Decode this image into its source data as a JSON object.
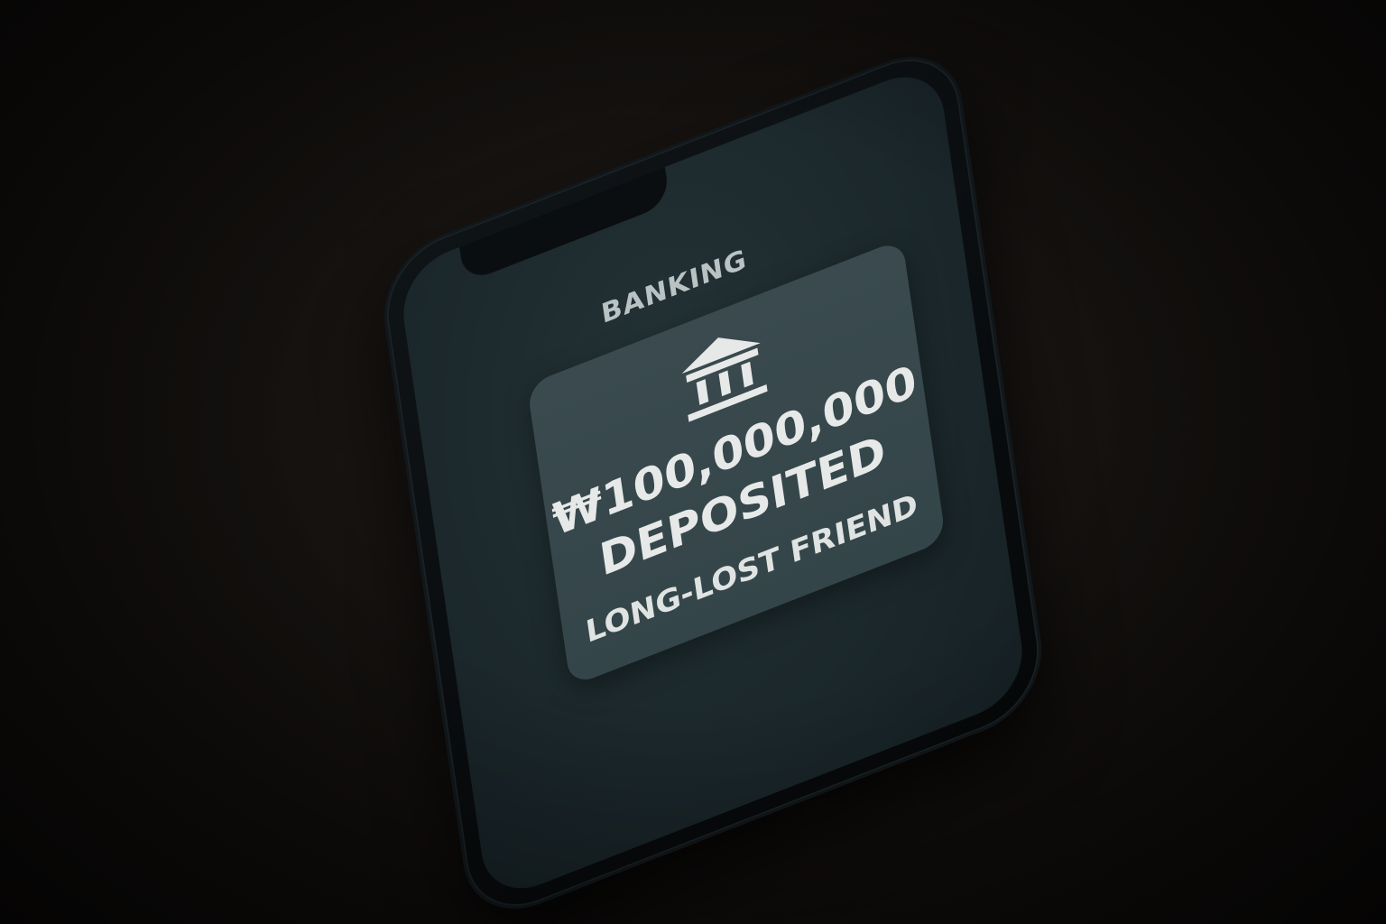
{
  "screen": {
    "title": "BANKING"
  },
  "notification": {
    "icon": "bank-icon",
    "amount": "₩100,000,000",
    "status": "DEPOSITED",
    "sender": "LONG-LOST FRIEND"
  },
  "colors": {
    "screen_background": "#1d2a2e",
    "card_background": "#3a4a4e",
    "text_primary": "#e6e9e8",
    "text_secondary": "#b9c3c4"
  }
}
